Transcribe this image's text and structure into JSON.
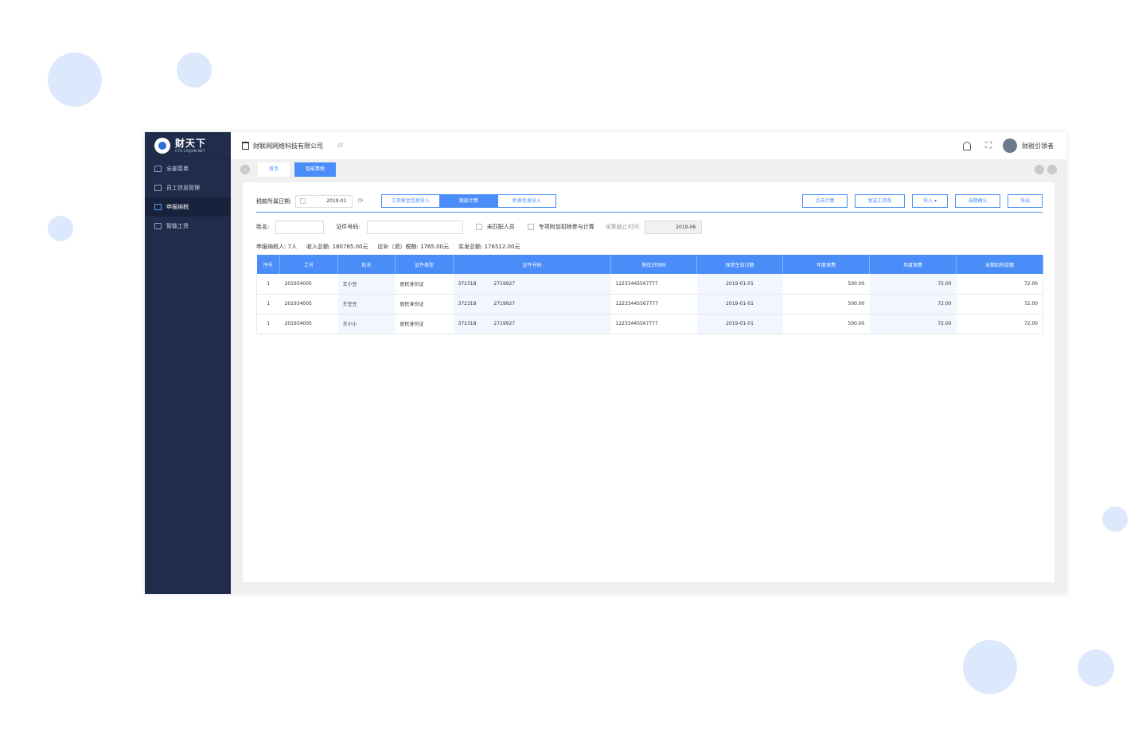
{
  "brand": {
    "name": "财天下",
    "sub": "CTX.CAIJIAN.NET"
  },
  "sidebar": {
    "items": [
      {
        "label": "全部菜单"
      },
      {
        "label": "员工信息管理"
      },
      {
        "label": "申报纳税"
      },
      {
        "label": "智能工资"
      }
    ]
  },
  "header": {
    "company": "财联网网络科技有限公司",
    "user": "财税引领者"
  },
  "tabs": [
    {
      "label": "首页"
    },
    {
      "label": "智能算税"
    }
  ],
  "toolbar": {
    "period_label": "税款所属日期:",
    "period_value": "2019-01",
    "steps": [
      {
        "label": "工资薪金信息导入"
      },
      {
        "label": "税款计算"
      },
      {
        "label": "附表信息导入"
      }
    ],
    "buttons": [
      {
        "label": "点击计算"
      },
      {
        "label": "发送工资条"
      },
      {
        "label": "导入"
      },
      {
        "label": "当期确认"
      },
      {
        "label": "导出"
      }
    ]
  },
  "filters": {
    "name_label": "姓名:",
    "id_label": "证件号码:",
    "unmatched_label": "未匹配人员",
    "special_label": "专项附加扣除参与计算",
    "deadline_label": "采集截止时间:",
    "deadline_value": "2019-06"
  },
  "summary": {
    "taxpayers": "申报纳税人:  7人",
    "income": "收入总额:  180765.00元",
    "tax": "应补（退）税额:  1765.00元",
    "payout": "实发总额:  176512.00元"
  },
  "table": {
    "columns": [
      "序号",
      "工号",
      "姓名",
      "证件类型",
      "证件号码",
      "税优识别码",
      "保单生效日期",
      "年度保费",
      "月度保费",
      "本期扣除金额"
    ],
    "rows": [
      {
        "no": "1",
        "emp_id": "201934005",
        "name": "王小豆",
        "id_type": "居民身份证",
        "id_a": "372318",
        "id_b": "2719927",
        "tax_code": "12233445567777",
        "date": "2019-01-01",
        "annual": "500.00",
        "monthly": "72.00",
        "deduct": "72.00"
      },
      {
        "no": "1",
        "emp_id": "201934005",
        "name": "王豆豆",
        "id_type": "居民身份证",
        "id_a": "372318",
        "id_b": "2719927",
        "tax_code": "12233445567777",
        "date": "2019-01-01",
        "annual": "500.00",
        "monthly": "72.00",
        "deduct": "72.00"
      },
      {
        "no": "1",
        "emp_id": "201934005",
        "name": "王小小",
        "id_type": "居民身份证",
        "id_a": "372318",
        "id_b": "2719927",
        "tax_code": "12233445567777",
        "date": "2019-01-01",
        "annual": "500.00",
        "monthly": "72.00",
        "deduct": "72.00"
      }
    ]
  }
}
